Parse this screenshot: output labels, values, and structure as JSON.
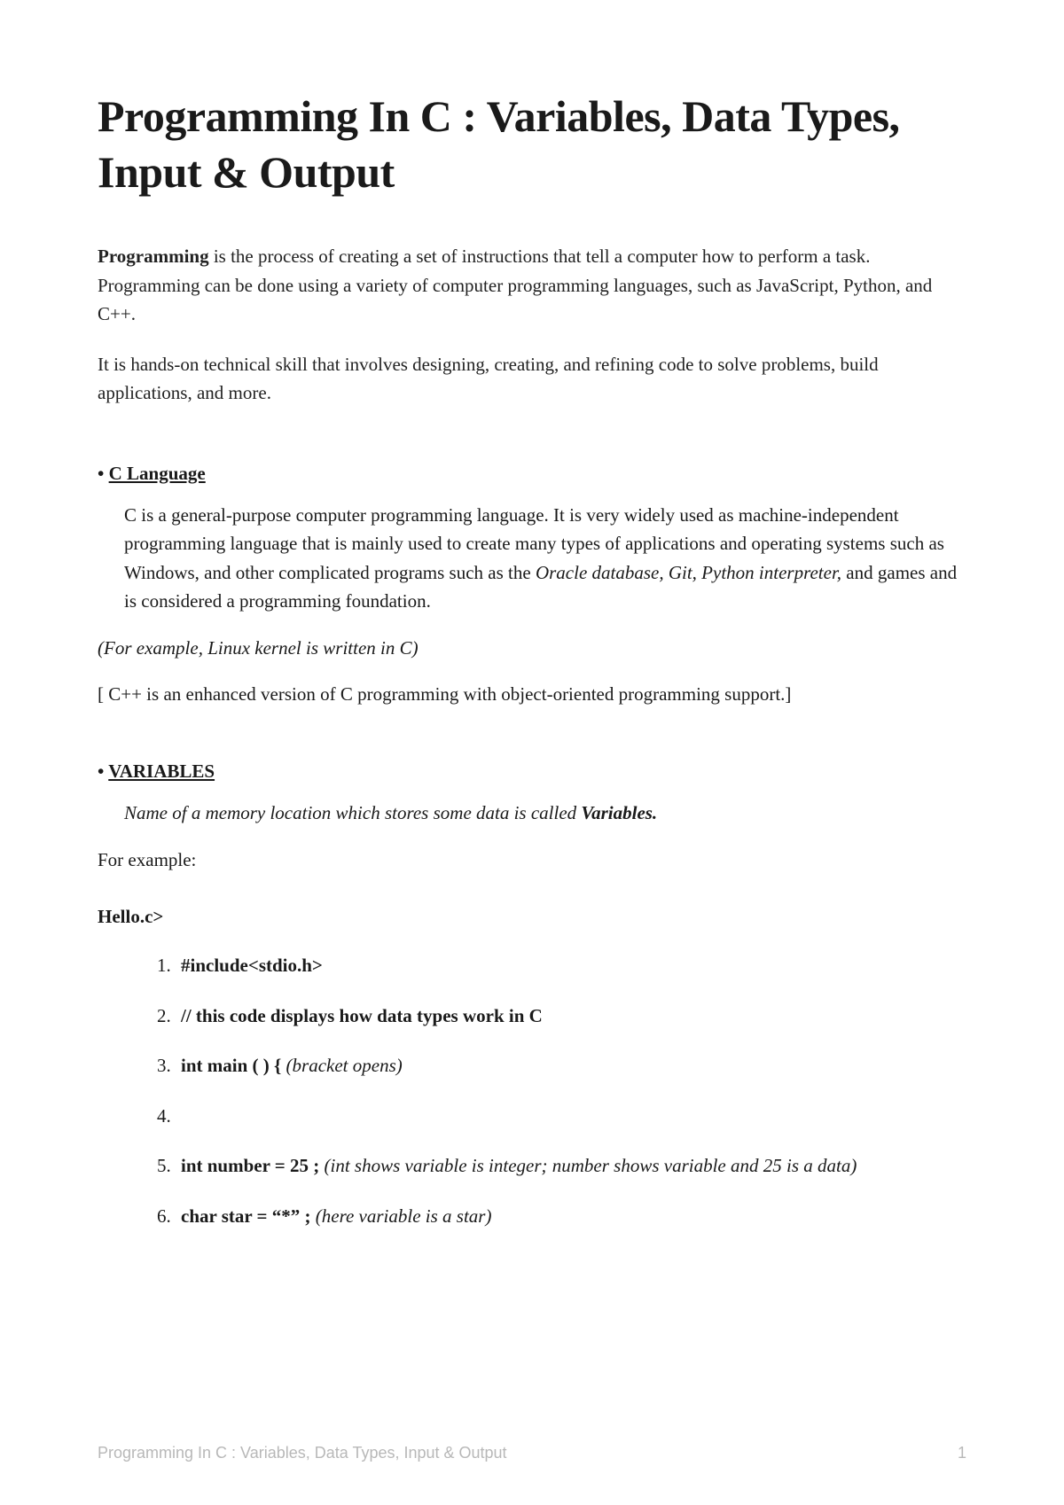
{
  "title": "Programming In C : Variables, Data Types, Input & Output",
  "intro": {
    "p1_bold": "Programming",
    "p1_rest": " is the process of creating a set of instructions that tell a computer how to perform a task. Programming can be done using a variety of computer programming languages, such as JavaScript, Python, and C++.",
    "p2": "It is hands-on technical skill that involves designing, creating, and refining code to solve problems, build applications, and more."
  },
  "section_c": {
    "bullet": "•",
    "heading": "C Language",
    "body_pre": "C is a general-purpose computer programming language.  It is very widely used as machine-independent programming language that is mainly used to create many types of applications and operating systems such as Windows, and other complicated programs such as the ",
    "body_em": "Oracle database, Git, Python interpreter,",
    "body_post": " and games and is considered a programming foundation.",
    "example": "(For example, Linux kernel is written in C)",
    "cpp_note": "[ C++ is an enhanced version of C programming with object-oriented programming support.]"
  },
  "section_vars": {
    "bullet": "•",
    "heading": "VARIABLES",
    "def_pre": "Name of a memory location which stores some data is called ",
    "def_bold": "Variables.",
    "for_example": "For example:"
  },
  "code": {
    "filename": "Hello.c>",
    "lines": [
      {
        "bold": "#include<stdio.h>",
        "comment": ""
      },
      {
        "bold": "// this code displays how data types work in C",
        "comment": ""
      },
      {
        "bold": "int main ( ) {",
        "comment": "  (bracket opens)"
      },
      {
        "bold": "",
        "comment": ""
      },
      {
        "bold": "  int number = 25 ;",
        "comment": " (int shows variable is integer; number shows variable and 25 is a data)"
      },
      {
        "bold": "   char star = “*” ;",
        "comment": "  (here variable is a star)"
      }
    ]
  },
  "footer": {
    "title": "Programming In C : Variables, Data Types, Input & Output",
    "page": "1"
  }
}
